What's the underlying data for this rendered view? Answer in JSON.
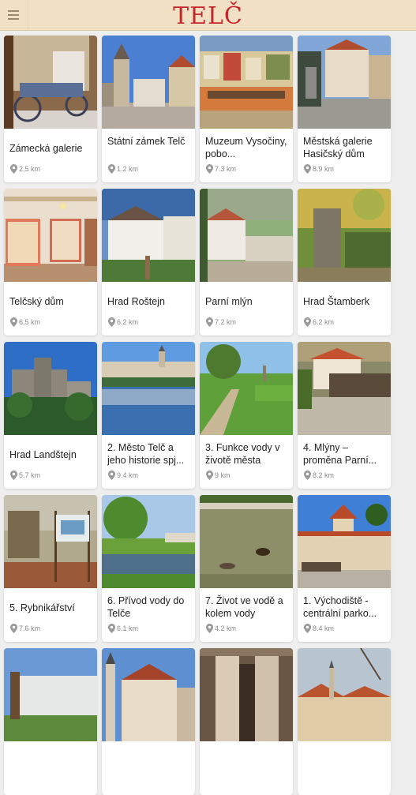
{
  "app": {
    "title": "TELČ",
    "menu_icon": "hamburger-icon"
  },
  "colors": {
    "appbar_bg": "#f1e0c3",
    "title": "#c4262e",
    "background": "#eeeeee"
  },
  "places": [
    {
      "title": "Zámecká galerie",
      "distance": "2.5 km",
      "photo": "carriage"
    },
    {
      "title": "Státní zámek Telč",
      "distance": "1.2 km",
      "photo": "town-square"
    },
    {
      "title": "Muzeum Vysočiny, pobo...",
      "distance": "7.3 km",
      "photo": "painting"
    },
    {
      "title": "Městská galerie Hasičský dům",
      "distance": "8.9 km",
      "photo": "fountain"
    },
    {
      "title": "Telčský dům",
      "distance": "6.5 km",
      "photo": "interior"
    },
    {
      "title": "Hrad Roštejn",
      "distance": "6.2 km",
      "photo": "castle-white"
    },
    {
      "title": "Parní mlýn",
      "distance": "7.2 km",
      "photo": "mill"
    },
    {
      "title": "Hrad Štamberk",
      "distance": "6.2 km",
      "photo": "ruin-trees"
    },
    {
      "title": "Hrad Landštejn",
      "distance": "5.7 km",
      "photo": "castle-ruin"
    },
    {
      "title": "2. Město Telč a jeho historie spj...",
      "distance": "9.4 km",
      "photo": "pond-town"
    },
    {
      "title": "3. Funkce vody v životě města",
      "distance": "9 km",
      "photo": "park-path"
    },
    {
      "title": "4. Mlýny – proměna Parní...",
      "distance": "8.2 km",
      "photo": "bridge-house"
    },
    {
      "title": "5. Rybnikářství",
      "distance": "7.6 km",
      "photo": "signboard"
    },
    {
      "title": "6. Přívod vody do Telče",
      "distance": "6.1 km",
      "photo": "canal"
    },
    {
      "title": "7. Život ve vodě a kolem vody",
      "distance": "4.2 km",
      "photo": "ducks"
    },
    {
      "title": "1. Východiště - centrální parko...",
      "distance": "8.4 km",
      "photo": "chateau-park"
    },
    {
      "title": "",
      "distance": "",
      "photo": "statue-building"
    },
    {
      "title": "",
      "distance": "",
      "photo": "church-tower"
    },
    {
      "title": "",
      "distance": "",
      "photo": "arcade"
    },
    {
      "title": "",
      "distance": "",
      "photo": "town-trees"
    }
  ]
}
